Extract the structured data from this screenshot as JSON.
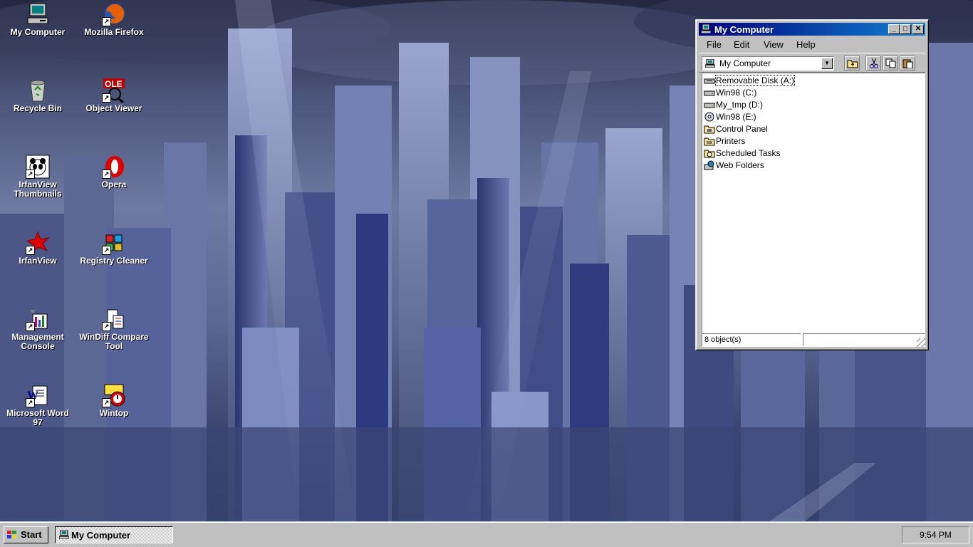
{
  "desktop": {
    "icons": [
      {
        "label": "My Computer",
        "icon": "my-computer-icon"
      },
      {
        "label": "Mozilla Firefox",
        "icon": "firefox-icon"
      },
      {
        "label": "Recycle Bin",
        "icon": "recycle-bin-icon"
      },
      {
        "label": "Object Viewer",
        "icon": "object-viewer-icon"
      },
      {
        "label": "IrfanView Thumbnails",
        "icon": "irfanview-thumbnails-icon"
      },
      {
        "label": "Opera",
        "icon": "opera-icon"
      },
      {
        "label": "IrfanView",
        "icon": "irfanview-icon"
      },
      {
        "label": "Registry Cleaner",
        "icon": "registry-cleaner-icon"
      },
      {
        "label": "Management Console",
        "icon": "management-console-icon"
      },
      {
        "label": "WinDiff Compare Tool",
        "icon": "windiff-icon"
      },
      {
        "label": "Microsoft Word 97",
        "icon": "word-icon"
      },
      {
        "label": "Wintop",
        "icon": "wintop-icon"
      }
    ]
  },
  "window": {
    "title": "My Computer",
    "menu": [
      "File",
      "Edit",
      "View",
      "Help"
    ],
    "address": "My Computer",
    "items": [
      {
        "label": "Removable Disk (A:)",
        "icon": "floppy-drive-icon"
      },
      {
        "label": "Win98 (C:)",
        "icon": "hard-drive-icon"
      },
      {
        "label": "My_tmp (D:)",
        "icon": "hard-drive-icon"
      },
      {
        "label": "Win98 (E:)",
        "icon": "cd-drive-icon"
      },
      {
        "label": "Control Panel",
        "icon": "control-panel-folder-icon"
      },
      {
        "label": "Printers",
        "icon": "printers-folder-icon"
      },
      {
        "label": "Scheduled Tasks",
        "icon": "scheduled-tasks-folder-icon"
      },
      {
        "label": "Web Folders",
        "icon": "web-folders-icon"
      }
    ],
    "status": "8 object(s)"
  },
  "taskbar": {
    "start_label": "Start",
    "task_label": "My Computer",
    "clock": "9:54 PM"
  },
  "colors": {
    "title_active_start": "#000080",
    "title_active_end": "#1084d0",
    "face": "#c0c0c0"
  }
}
